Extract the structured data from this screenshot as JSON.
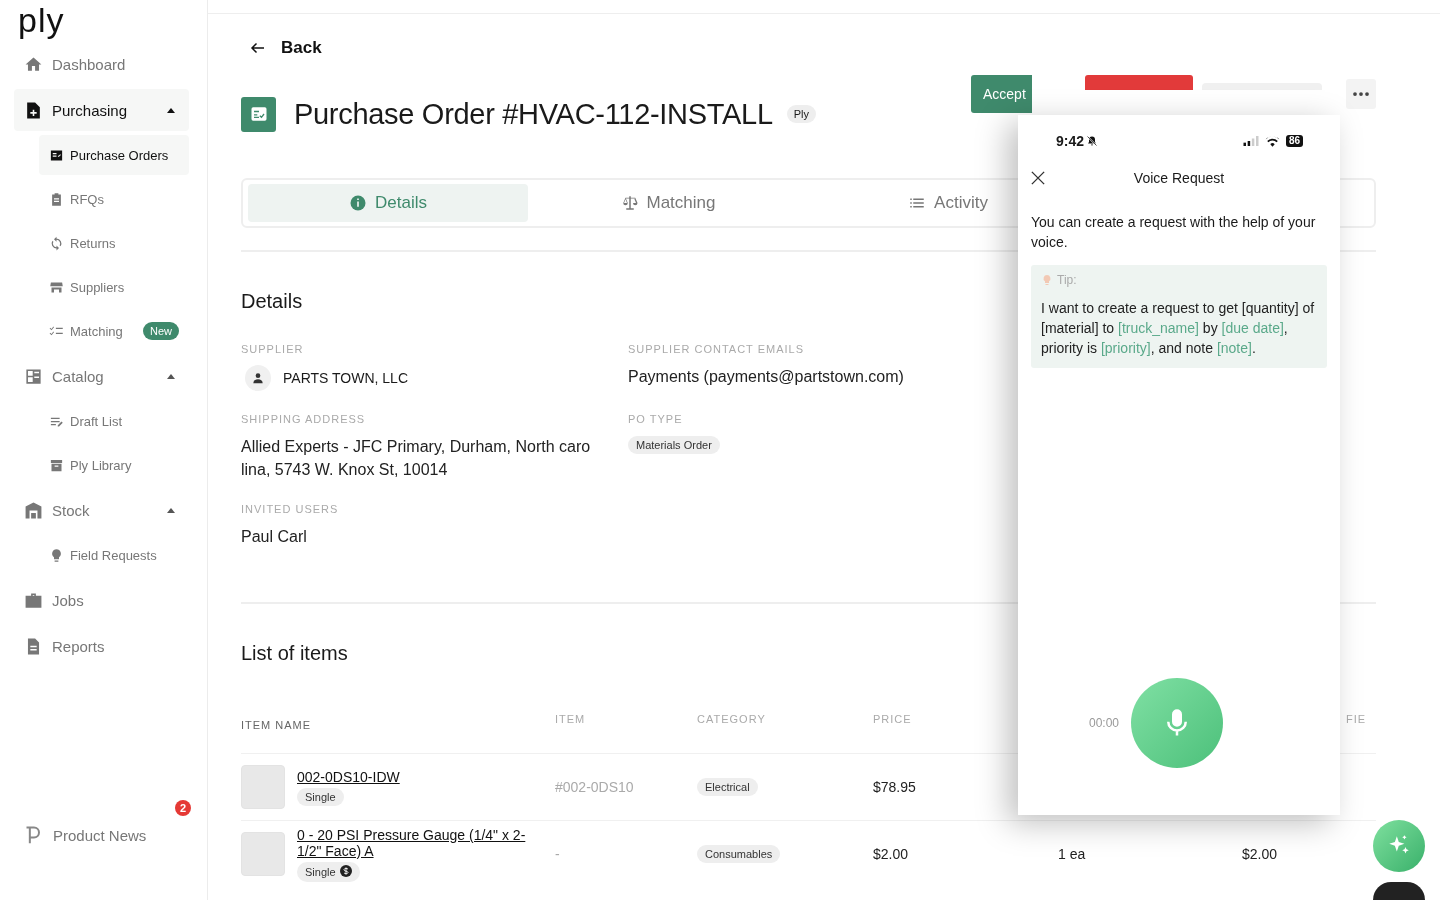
{
  "logo": "ply",
  "sidebar": {
    "items": [
      {
        "label": "Dashboard",
        "selected": false
      },
      {
        "label": "Purchasing",
        "selected": true,
        "expanded": true,
        "children": [
          {
            "label": "Purchase Orders",
            "selected": true
          },
          {
            "label": "RFQs",
            "selected": false
          },
          {
            "label": "Returns",
            "selected": false
          },
          {
            "label": "Suppliers",
            "selected": false
          },
          {
            "label": "Matching",
            "selected": false,
            "badge": "New"
          }
        ]
      },
      {
        "label": "Catalog",
        "selected": false,
        "expanded": true,
        "children": [
          {
            "label": "Draft List",
            "selected": false
          },
          {
            "label": "Ply Library",
            "selected": false
          }
        ]
      },
      {
        "label": "Stock",
        "selected": false,
        "expanded": true,
        "children": [
          {
            "label": "Field Requests",
            "selected": false
          }
        ]
      },
      {
        "label": "Jobs",
        "selected": false
      },
      {
        "label": "Reports",
        "selected": false
      }
    ],
    "footer": {
      "label": "Product News",
      "count": "2"
    }
  },
  "back": "Back",
  "title": "Purchase Order #HVAC-112-INSTALL",
  "title_tag": "Ply",
  "actions": [
    {
      "label": "Accept",
      "kind": "accept"
    },
    {
      "kind": "decline"
    },
    {
      "kind": "neutral"
    },
    {
      "kind": "more"
    }
  ],
  "tabs": [
    {
      "label": "Details",
      "selected": true
    },
    {
      "label": "Matching",
      "selected": false
    },
    {
      "label": "Activity",
      "selected": false
    }
  ],
  "details": {
    "heading": "Details",
    "fields": [
      {
        "label": "SUPPLIER",
        "kind": "person",
        "value": "PARTS TOWN, LLC"
      },
      {
        "label": "SUPPLIER CONTACT EMAILS",
        "kind": "text",
        "value": "Payments (payments@partstown.com)"
      },
      {
        "label": "SHIPPING ADDRESS",
        "kind": "text",
        "value": "Allied Experts - JFC Primary, Durham, North caro lina, 5743 W. Knox St, 10014"
      },
      {
        "label": "PO TYPE",
        "kind": "tag",
        "value": "Materials Order"
      },
      {
        "label": "INVITED USERS",
        "kind": "text",
        "value": "Paul Carl"
      }
    ]
  },
  "items": {
    "heading": "List of items",
    "columns": {
      "item_name": "ITEM NAME",
      "item": "ITEM",
      "category": "CATEGORY",
      "price": "PRICE",
      "column_7": "FIE"
    },
    "rows": [
      {
        "name": "002-0DS10-IDW",
        "tag": "Single",
        "tag_icon": false,
        "item": "#002-0DS10",
        "category": "Electrical",
        "price": "$78.95"
      },
      {
        "name": "0 - 20 PSI Pressure Gauge (1/4\" x 2-1/2\" Face) A",
        "tag": "Single",
        "tag_icon": true,
        "item": "-",
        "category": "Consumables",
        "price": "$2.00",
        "quantity": "1 ea",
        "total": "$2.00"
      }
    ]
  },
  "phone": {
    "time": "9:42",
    "battery": "86",
    "title": "Voice Request",
    "intro": "You can create a request with the help of your voice.",
    "tip_label": "Tip:",
    "tip": [
      {
        "kind": "text",
        "text": "I want to create a request to get [quantity] of [material] to "
      },
      {
        "kind": "var",
        "text": "[truck_name]"
      },
      {
        "kind": "text",
        "text": " by "
      },
      {
        "kind": "var",
        "text": "[due date]"
      },
      {
        "kind": "text",
        "text": ", priority is "
      },
      {
        "kind": "var",
        "text": "[priority]"
      },
      {
        "kind": "text",
        "text": ", and note "
      },
      {
        "kind": "var",
        "text": "[note]"
      },
      {
        "kind": "text",
        "text": "."
      }
    ],
    "timer": "00:00"
  }
}
